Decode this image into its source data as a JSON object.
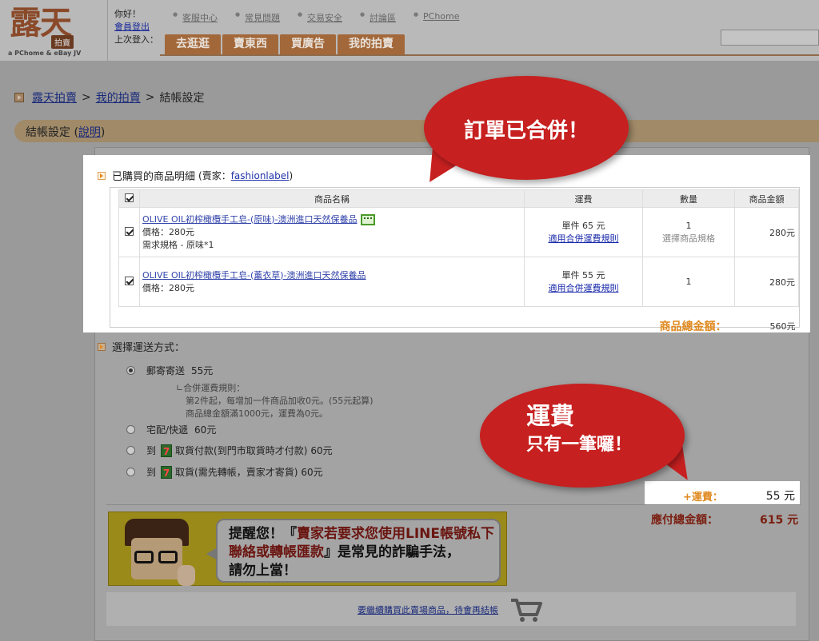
{
  "header": {
    "logo_big": "露天",
    "logo_badge": "拍賣",
    "logo_tagline": "a PChome & eBay JV",
    "greeting": "你好！",
    "logout": "會員登出",
    "last_login": "上次登入：",
    "top_links": [
      "客服中心",
      "常見問題",
      "交易安全",
      "討論區",
      "PChome"
    ],
    "nav_tabs": [
      "去逛逛",
      "賣東西",
      "買廣告",
      "我的拍賣"
    ]
  },
  "breadcrumb": {
    "root": "露天拍賣",
    "mid": "我的拍賣",
    "current": "結帳設定",
    "sep": ">"
  },
  "section": {
    "title": "結帳設定",
    "help_open": " (",
    "help_link": "說明",
    "help_close": ")"
  },
  "order": {
    "heading": "已購買的商品明細",
    "seller_prefix": "(賣家：",
    "seller": "fashionlabel",
    "seller_suffix": ")",
    "columns": [
      "商品名稱",
      "運費",
      "數量",
      "商品金額"
    ],
    "items": [
      {
        "name": "OLIVE OIL初榨橄欖手工皂-(原味)-澳洲進口天然保養品",
        "price": "價格：280元",
        "spec": "需求規格 - 原味*1",
        "ship_fee": "單件 65 元",
        "ship_rule": "適用合併運費規則",
        "qty": "1",
        "qty_sub": "選擇商品規格",
        "amount": "280元"
      },
      {
        "name": "OLIVE OIL初榨橄欖手工皂-(薰衣草)-澳洲進口天然保養品",
        "price": "價格：280元",
        "ship_fee": "單件 55 元",
        "ship_rule": "適用合併運費規則",
        "qty": "1",
        "amount": "280元"
      }
    ],
    "total_label": "商品總金額：",
    "total_value": "560元"
  },
  "shipping": {
    "heading": "選擇運送方式：",
    "options": [
      {
        "prefix": "",
        "label": "郵寄寄送",
        "fee": "55元",
        "selected": true
      },
      {
        "prefix": "",
        "label": "宅配/快遞",
        "fee": "60元",
        "selected": false
      },
      {
        "prefix": "到",
        "label": "取貨付款(到門市取貨時才付款)",
        "fee": "60元",
        "selected": false
      },
      {
        "prefix": "到",
        "label": "取貨(需先轉帳，賣家才寄貨)",
        "fee": "60元",
        "selected": false
      }
    ],
    "seven_logo": "7",
    "rule_title": "合併運費規則：",
    "rule_line1": "第2件起，每增加一件商品加收0元。(55元起算)",
    "rule_line2": "商品總金額滿1000元，運費為0元。"
  },
  "fees": {
    "ship_label": "+運費：",
    "ship_value": "55 元",
    "grand_label": "應付總金額：",
    "grand_value": "615 元"
  },
  "warning": {
    "line1_a": "提醒您！『",
    "line1_red": "賣家若要求您使用LINE帳號私下聯絡或轉帳匯款",
    "line1_b": "』是常見的詐騙手法，",
    "line2": "請勿上當！"
  },
  "cart": {
    "link": "要繼續購買此賣場商品，待會再結帳"
  },
  "callouts": {
    "merged": "訂單已合併！",
    "ship_title": "運費",
    "ship_sub": "只有一筆囉！"
  },
  "colors": {
    "accent_red": "#c72020",
    "nav_brown": "#a3683a",
    "total_orange": "#e08a20"
  }
}
